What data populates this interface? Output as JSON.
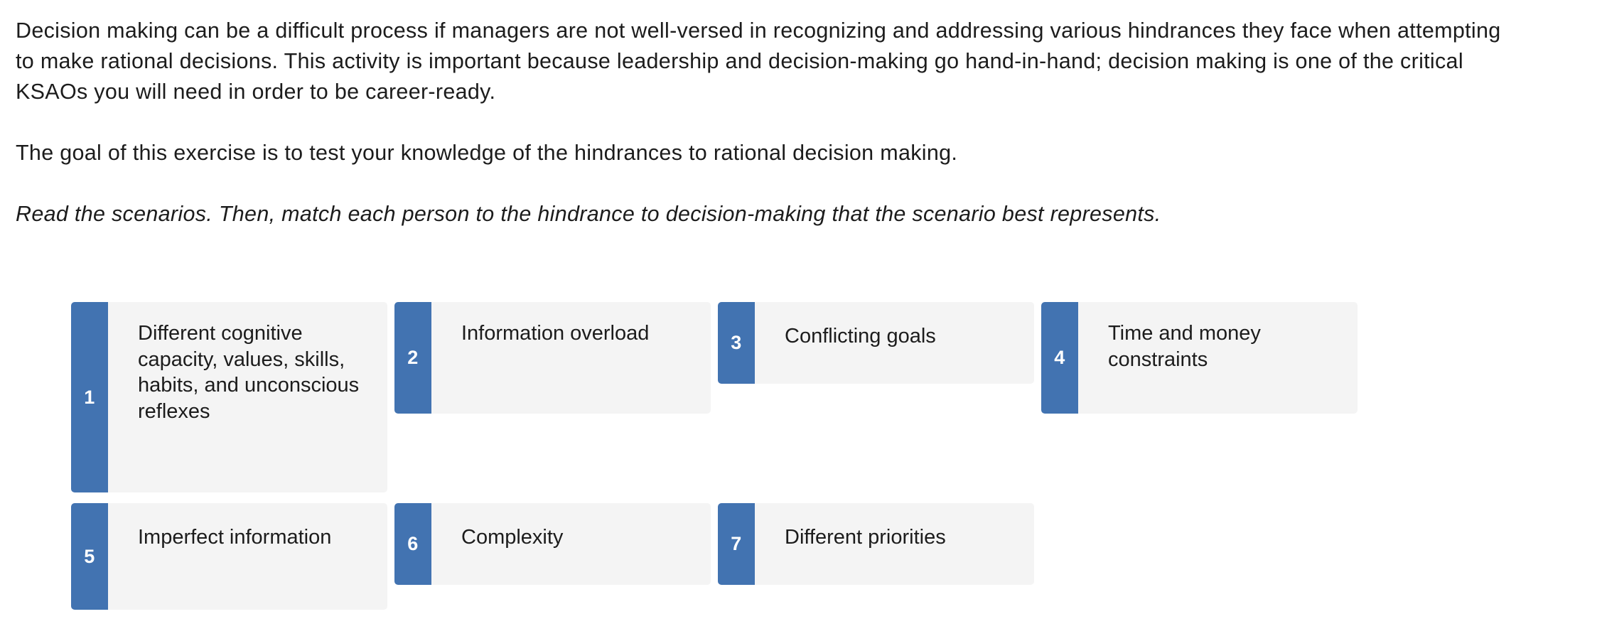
{
  "intro": {
    "paragraph_1_line_1": "Decision making can be a difficult process if managers are not well-versed in recognizing and addressing various hindrances they face when attempting",
    "paragraph_1_line_2": "to make rational decisions. This activity is important because leadership and decision-making go hand-in-hand; decision making is one of the critical",
    "paragraph_1_line_3": "KSAOs you will need in order to be career-ready.",
    "paragraph_2": "The goal of this exercise is to test your knowledge of the hindrances to rational decision making.",
    "instruction": "Read the scenarios. Then, match each person to the hindrance to decision-making that the scenario best represents."
  },
  "theme": {
    "accent_blue": "#4273b1",
    "card_background": "#f4f4f4",
    "text_color": "#1c1c1c",
    "number_text_color": "#ffffff"
  },
  "cards": {
    "row_1": [
      {
        "number": "1",
        "label": "Different cognitive capacity, values, skills, habits, and unconscious reflexes"
      },
      {
        "number": "2",
        "label": "Information overload"
      },
      {
        "number": "3",
        "label": "Conflicting goals"
      },
      {
        "number": "4",
        "label": "Time and money constraints"
      }
    ],
    "row_2": [
      {
        "number": "5",
        "label": "Imperfect information"
      },
      {
        "number": "6",
        "label": "Complexity"
      },
      {
        "number": "7",
        "label": "Different priorities"
      }
    ]
  }
}
